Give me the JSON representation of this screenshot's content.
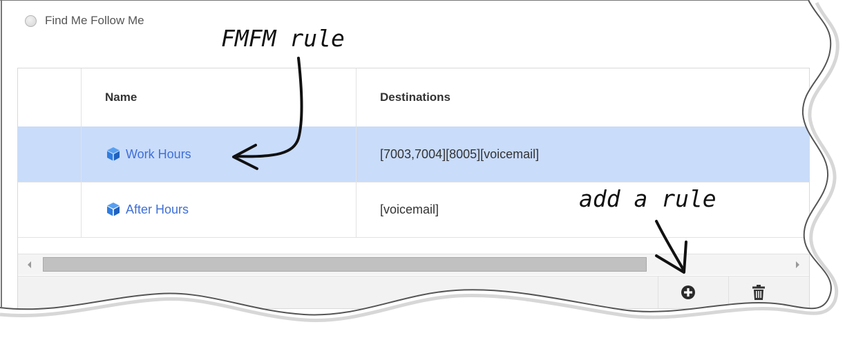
{
  "option": {
    "label": "Find Me Follow Me"
  },
  "table": {
    "columns": [
      "Name",
      "Destinations"
    ],
    "rows": [
      {
        "name": "Work Hours",
        "destinations": "[7003,7004][8005][voicemail]"
      },
      {
        "name": "After Hours",
        "destinations": "[voicemail]"
      }
    ]
  },
  "toolbar": {
    "add_icon": "plus-circle-icon",
    "delete_icon": "trash-icon"
  },
  "annotations": {
    "fmfm": "FMFM rule",
    "add": "add a rule"
  },
  "colors": {
    "selected_row": "#c9dcfa",
    "link": "#3f6fd6",
    "cube": "#2f7de1"
  }
}
